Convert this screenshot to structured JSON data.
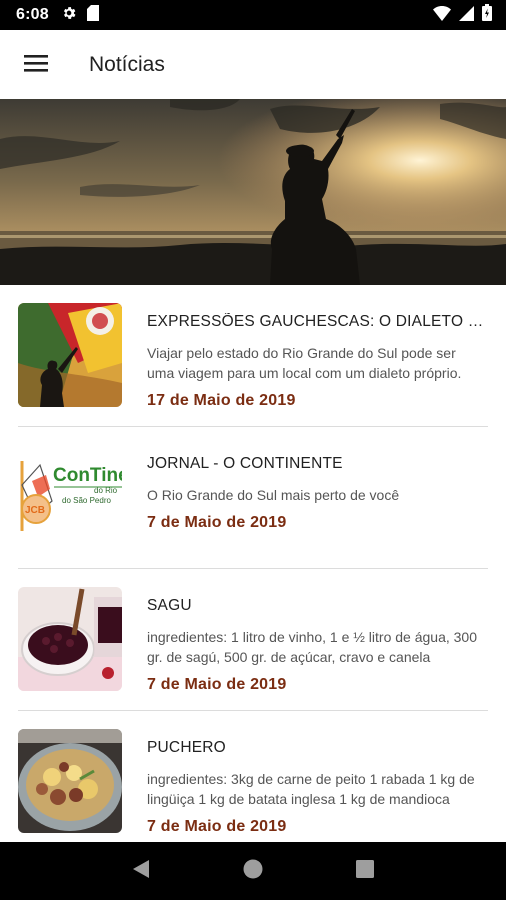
{
  "status_bar": {
    "time": "6:08"
  },
  "app_bar": {
    "title": "Notícias"
  },
  "news": [
    {
      "title": "EXPRESSÕES GAUCHESCAS: O DIALETO GAÚCHO",
      "description": "Viajar pelo estado do Rio Grande do Sul pode ser uma viagem para um local com um dialeto próprio.",
      "date": "17 de Maio de 2019"
    },
    {
      "title": "JORNAL - O CONTINENTE",
      "description": "O Rio Grande do Sul mais perto de você",
      "date": "7 de Maio de 2019",
      "logo": {
        "line1": "ConTine",
        "line2": "do Rio",
        "line3": "do São Pedro",
        "badge": "JCB"
      }
    },
    {
      "title": "SAGU",
      "description": "ingredientes: 1 litro de vinho, 1 e ½ litro de água, 300 gr. de sagú, 500 gr. de açúcar, cravo e canela",
      "date": "7 de Maio de 2019"
    },
    {
      "title": "PUCHERO",
      "description": "ingredientes: 3kg de carne de peito 1 rabada 1 kg de lingüiça 1 kg de batata inglesa 1 kg de mandioca",
      "date": "7 de Maio de 2019"
    }
  ],
  "colors": {
    "accent": "#7b2d12",
    "status_bar": "#000000"
  }
}
